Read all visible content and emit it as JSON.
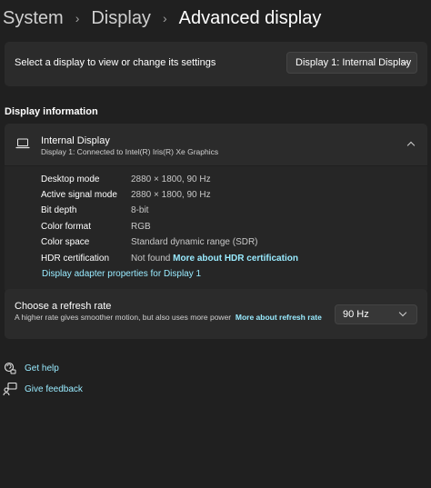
{
  "breadcrumb": {
    "items": [
      "System",
      "Display"
    ],
    "current": "Advanced display",
    "separator": "›"
  },
  "display_select": {
    "label": "Select a display to view or change its settings",
    "value": "Display 1: Internal Display"
  },
  "display_info": {
    "section_title": "Display information",
    "title": "Internal Display",
    "subtitle": "Display 1: Connected to Intel(R) Iris(R) Xe Graphics",
    "rows": [
      {
        "label": "Desktop mode",
        "value": "2880 × 1800, 90 Hz"
      },
      {
        "label": "Active signal mode",
        "value": "2880 × 1800, 90 Hz"
      },
      {
        "label": "Bit depth",
        "value": "8-bit"
      },
      {
        "label": "Color format",
        "value": "RGB"
      },
      {
        "label": "Color space",
        "value": "Standard dynamic range (SDR)"
      },
      {
        "label": "HDR certification",
        "value": "Not found",
        "link": "More about HDR certification"
      }
    ],
    "adapter_link": "Display adapter properties for Display 1"
  },
  "refresh": {
    "title": "Choose a refresh rate",
    "description": "A higher rate gives smoother motion, but also uses more power",
    "link": "More about refresh rate",
    "value": "90 Hz"
  },
  "help": {
    "get_help": "Get help",
    "give_feedback": "Give feedback"
  },
  "colors": {
    "background": "#202020",
    "card": "#2b2b2b",
    "link": "#99ebff"
  },
  "icons": [
    "laptop-icon",
    "chevron-down-icon",
    "chevron-up-icon",
    "help-icon",
    "feedback-icon"
  ]
}
